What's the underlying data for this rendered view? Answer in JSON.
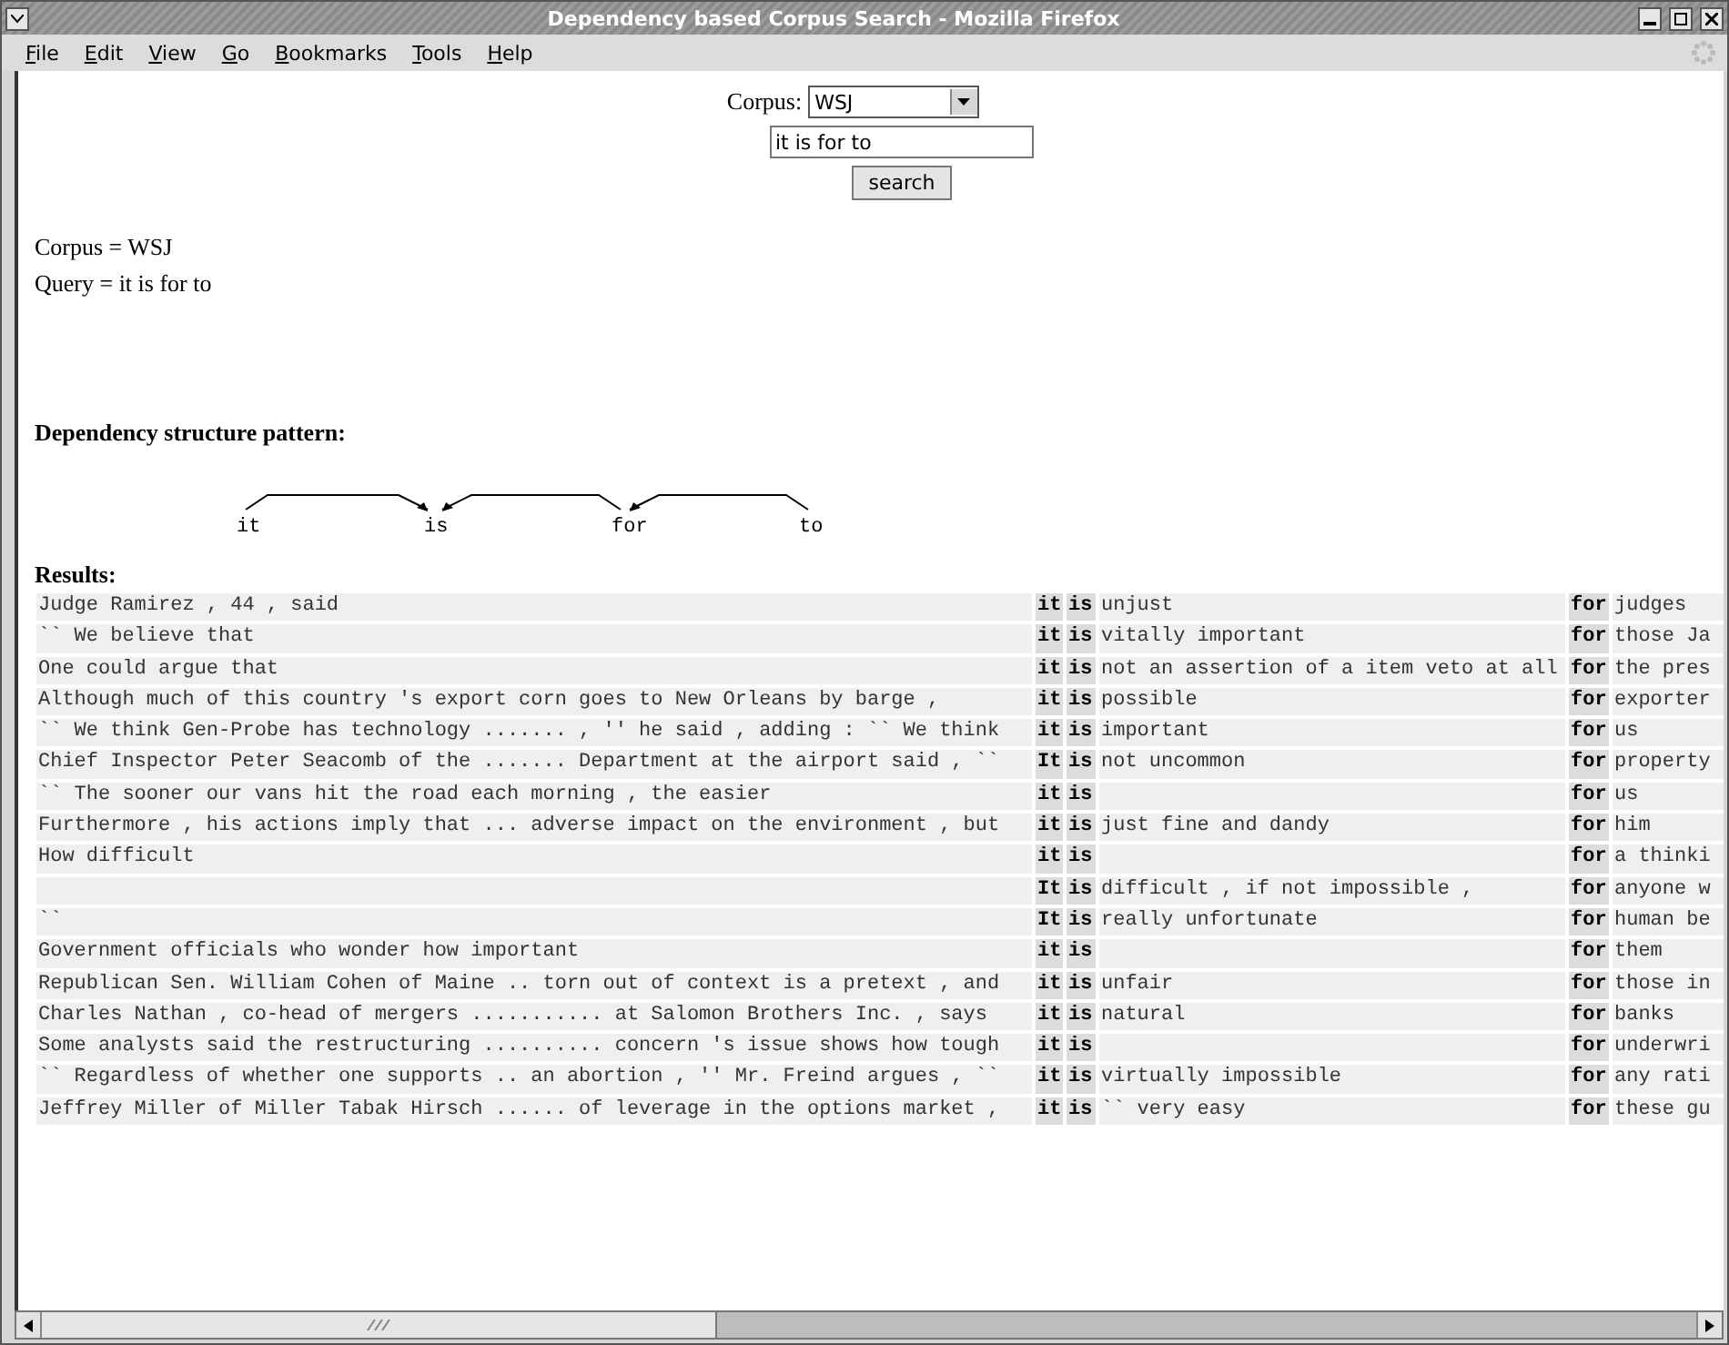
{
  "window": {
    "title": "Dependency based Corpus Search - Mozilla Firefox"
  },
  "menu": [
    "File",
    "Edit",
    "View",
    "Go",
    "Bookmarks",
    "Tools",
    "Help"
  ],
  "form": {
    "corpus_label": "Corpus:",
    "corpus_value": "WSJ",
    "query_value": "it is for to",
    "search_button": "search"
  },
  "summary": [
    "Corpus = WSJ",
    "Query = it is for to"
  ],
  "pattern_heading": "Dependency structure pattern:",
  "pattern_words": [
    {
      "word": "it",
      "kind": "right"
    },
    {
      "word": "is",
      "kind": "root"
    },
    {
      "word": "for",
      "kind": "left"
    },
    {
      "word": "to",
      "kind": "left"
    }
  ],
  "results_heading": "Results:",
  "results": [
    {
      "left": "Judge Ramirez , 44 , said",
      "it": "it",
      "is": "is",
      "middle": "unjust",
      "for": "for",
      "right": "judges"
    },
    {
      "left": "`` We believe that",
      "it": "it",
      "is": "is",
      "middle": "vitally important",
      "for": "for",
      "right": "those Ja"
    },
    {
      "left": "One could argue that",
      "it": "it",
      "is": "is",
      "middle": "not an assertion of a item veto at all",
      "for": "for",
      "right": "the pres"
    },
    {
      "left": "Although much of this country 's export corn goes to New Orleans by barge ,",
      "it": "it",
      "is": "is",
      "middle": "possible",
      "for": "for",
      "right": "exporter"
    },
    {
      "left": "`` We think Gen-Probe has technology ....... , '' he said , adding : `` We think",
      "it": "it",
      "is": "is",
      "middle": "important",
      "for": "for",
      "right": "us"
    },
    {
      "left": "Chief Inspector Peter Seacomb of the ....... Department at the airport said , ``",
      "it": "It",
      "is": "is",
      "middle": "not uncommon",
      "for": "for",
      "right": "property"
    },
    {
      "left": "`` The sooner our vans hit the road each morning , the easier",
      "it": "it",
      "is": "is",
      "for": "for",
      "right": "us"
    },
    {
      "left": "Furthermore , his actions imply that ... adverse impact on the environment , but",
      "it": "it",
      "is": "is",
      "middle": "just fine and dandy",
      "for": "for",
      "right": "him"
    },
    {
      "left": "How difficult",
      "it": "it",
      "is": "is",
      "for": "for",
      "right": "a thinki"
    },
    {
      "it": "It",
      "is": "is",
      "middle": "difficult , if not impossible ,",
      "for": "for",
      "right": "anyone w"
    },
    {
      "left": "``",
      "it": "It",
      "is": "is",
      "middle": "really unfortunate",
      "for": "for",
      "right": "human be"
    },
    {
      "left": "Government officials who wonder how important",
      "it": "it",
      "is": "is",
      "for": "for",
      "right": "them"
    },
    {
      "left": "Republican Sen. William Cohen of Maine .. torn out of context is a pretext , and",
      "it": "it",
      "is": "is",
      "middle": "unfair",
      "for": "for",
      "right": "those in"
    },
    {
      "left": "Charles Nathan , co-head of mergers ........... at Salomon Brothers Inc. , says",
      "it": "it",
      "is": "is",
      "middle": "natural",
      "for": "for",
      "right": "banks"
    },
    {
      "left": "Some analysts said the restructuring .......... concern 's issue shows how tough",
      "it": "it",
      "is": "is",
      "for": "for",
      "right": "underwri"
    },
    {
      "left": "`` Regardless of whether one supports .. an abortion , '' Mr. Freind argues , ``",
      "it": "it",
      "is": "is",
      "middle": "virtually impossible",
      "for": "for",
      "right": "any rati"
    },
    {
      "left": "Jeffrey Miller of Miller Tabak Hirsch ...... of leverage in the options market ,",
      "it": "it",
      "is": "is",
      "middle": "`` very easy",
      "for": "for",
      "right": "these gu"
    }
  ]
}
